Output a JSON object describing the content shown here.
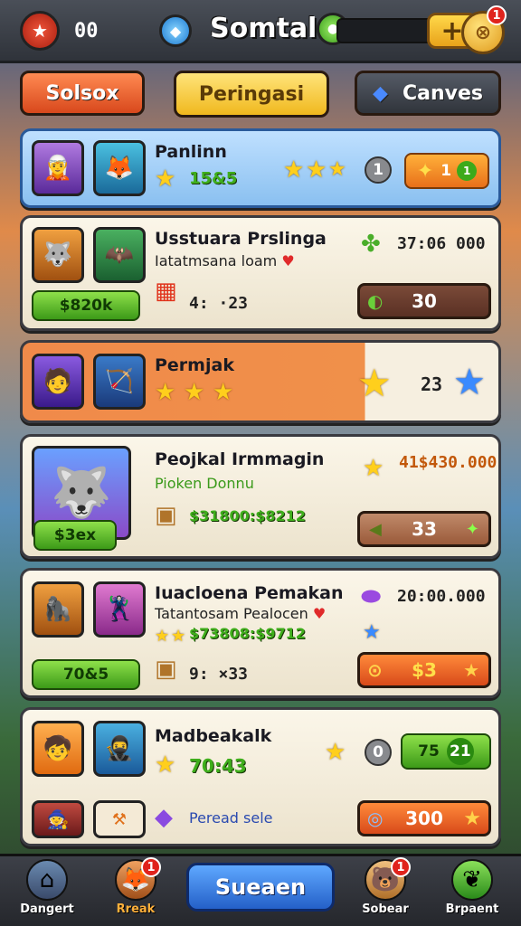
{
  "topbar": {
    "left_value": "00",
    "title": "Somtal",
    "coin_badge": "1"
  },
  "tabs": [
    {
      "label": "Solsox",
      "color": "#e8643a"
    },
    {
      "label": "Peringasi",
      "color": "#ffd24a"
    },
    {
      "label": "Canves",
      "color": "#3a4048"
    }
  ],
  "cards": [
    {
      "name": "Panlinn",
      "green_text": "15&5",
      "stars_count": 3,
      "circle_value": "1",
      "reward_value": "1",
      "reward_badge": "1"
    },
    {
      "name": "Usstuara Prslinga",
      "subtitle": "Iatatmsana loam",
      "green_pill": "$820k",
      "small_label": "4: ·23",
      "gem_value": "37:06 000",
      "slot_value": "30"
    },
    {
      "name": "Permjak",
      "stars_count": 3,
      "right_value": "23"
    },
    {
      "name": "Peojkal Irmmagin",
      "subtitle": "Pioken Donnu",
      "green_pill": "$3ex",
      "green_text": "$31800:$8212",
      "gold_value": "41$430.000",
      "slot_value": "33"
    },
    {
      "name": "Iuacloena Pemakan",
      "subtitle": "Tatantosam Pealocen",
      "green_text": "$73808:$9712",
      "green_pill": "70&5",
      "small_label": "9: ×33",
      "gem_value": "20:00.000",
      "slot_value": "$3"
    },
    {
      "name": "Madbeakalk",
      "green_text": "70:43",
      "circle_value": "0",
      "reward_left": "75",
      "reward_right": "21",
      "link_text": "Peread sele",
      "slot_value": "300"
    }
  ],
  "nav": {
    "items": [
      {
        "label": "Dangert",
        "icon": "home-icon"
      },
      {
        "label": "Rreak",
        "icon": "fox-icon",
        "badge": "1"
      },
      {
        "label": "Sobear",
        "icon": "bear-icon",
        "badge": "1"
      },
      {
        "label": "Brpaent",
        "icon": "leaf-icon"
      }
    ],
    "main_button": "Sueaen"
  }
}
